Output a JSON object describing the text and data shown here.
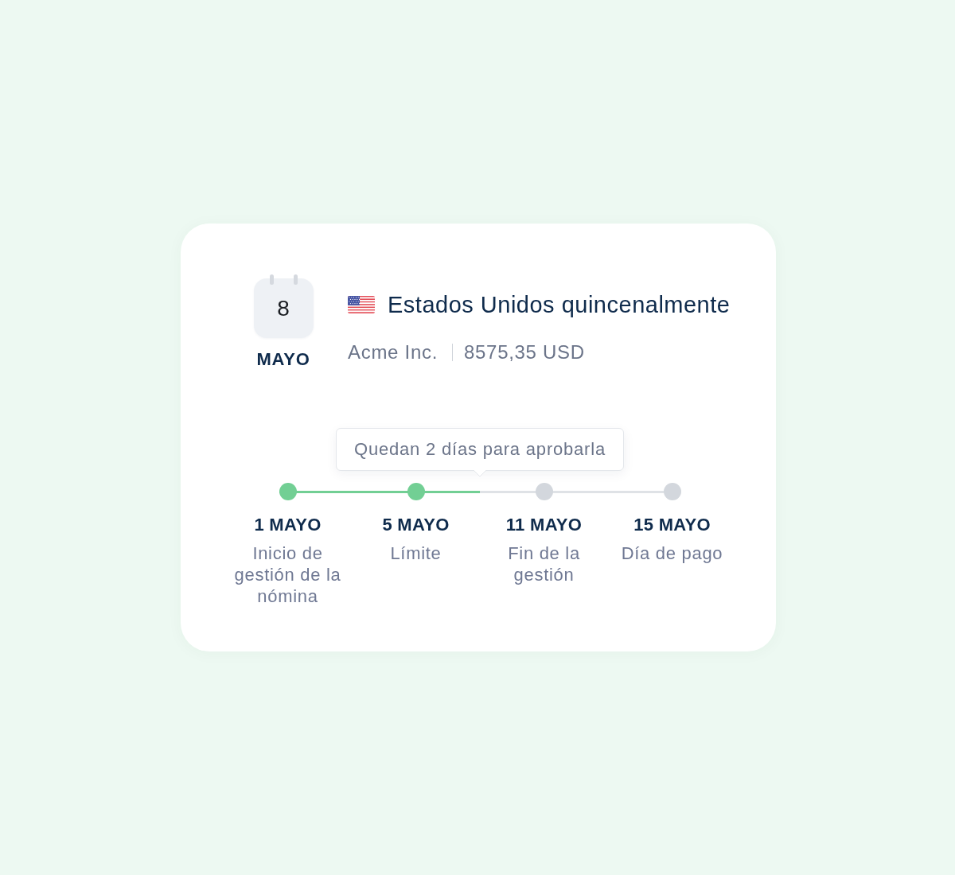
{
  "date_badge": {
    "day": "8",
    "month": "MAYO"
  },
  "payroll": {
    "title": "Estados Unidos quincenalmente",
    "company": "Acme Inc.",
    "amount": "8575,35 USD"
  },
  "timeline": {
    "tooltip": "Quedan 2 días para aprobarla",
    "level": 0.5,
    "milestones": [
      {
        "date": "1 MAYO",
        "label": "Inicio de gestión de la nómina",
        "completed": true
      },
      {
        "date": "5 MAYO",
        "label": "Límite",
        "completed": true
      },
      {
        "date": "11 MAYO",
        "label": "Fin de la gestión",
        "completed": false
      },
      {
        "date": "15 MAYO",
        "label": "Día de pago",
        "completed": false
      }
    ]
  }
}
